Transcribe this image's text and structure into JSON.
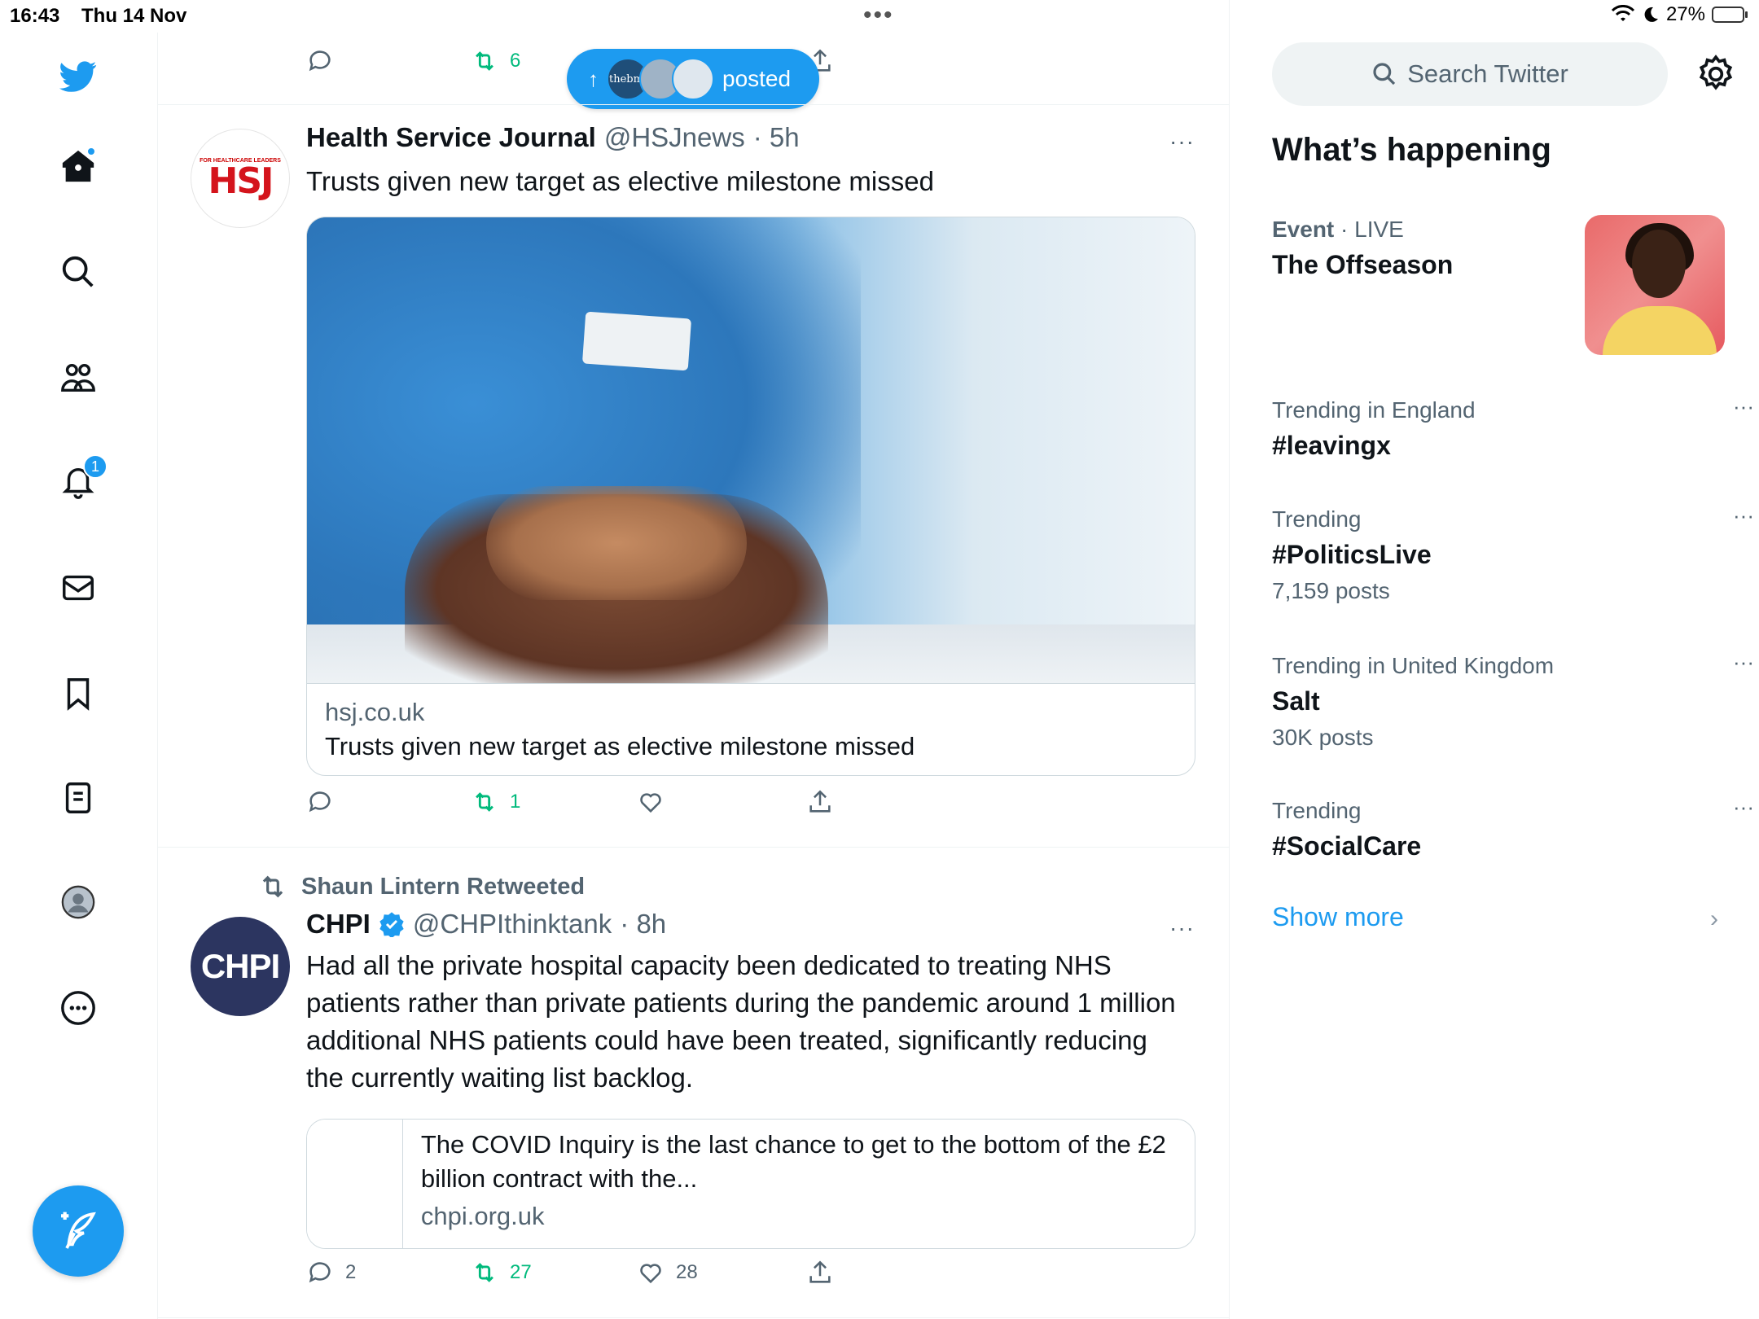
{
  "status_bar": {
    "time": "16:43",
    "date": "Thu 14 Nov",
    "battery": "27%",
    "battery_level": 0.27
  },
  "nav": {
    "notifications_count": "1"
  },
  "top_tweet_actions": {
    "retweets": "6"
  },
  "posted_pill": {
    "label": "posted",
    "avatar_text": "thebmj"
  },
  "tweets": [
    {
      "name": "Health Service Journal",
      "handle": "@HSJnews",
      "time": "· 5h",
      "avatar_small": "FOR HEALTHCARE LEADERS",
      "avatar_logo": "HSJ",
      "text": "Trusts given new target as elective milestone missed",
      "card": {
        "domain": "hsj.co.uk",
        "title": "Trusts given new target as elective milestone missed"
      },
      "replies": "",
      "retweets": "1",
      "likes": "",
      "more": "···"
    },
    {
      "retweeted_by": "Shaun Lintern Retweeted",
      "name": "CHPI",
      "handle": "@CHPIthinktank",
      "time": "· 8h",
      "avatar_text": "CHPI",
      "text": "Had all the private hospital capacity been dedicated to treating NHS patients rather than private patients during the pandemic around 1 million additional NHS patients could have been treated, significantly reducing the currently waiting list backlog.",
      "card": {
        "title": "The COVID Inquiry is the last chance to get to the bottom of the £2 billion contract with the...",
        "domain": "chpi.org.uk"
      },
      "replies": "2",
      "retweets": "27",
      "likes": "28",
      "more": "···"
    }
  ],
  "sidebar": {
    "search_placeholder": "Search Twitter",
    "section_title": "What’s happening",
    "event": {
      "category": "Event",
      "status": "· LIVE",
      "topic": "The Offseason"
    },
    "trends": [
      {
        "category": "Trending in England",
        "topic": "#leavingx",
        "count": ""
      },
      {
        "category": "Trending",
        "topic": "#PoliticsLive",
        "count": "7,159 posts"
      },
      {
        "category": "Trending in United Kingdom",
        "topic": "Salt",
        "count": "30K posts"
      },
      {
        "category": "Trending",
        "topic": "#SocialCare",
        "count": ""
      }
    ],
    "show_more": "Show more",
    "more_glyph": "···"
  },
  "colors": {
    "accent": "#1d9bf0",
    "retweet": "#00ba7c",
    "secondary_text": "#536471",
    "hsj_red": "#d4141c",
    "chpi_navy": "#2c3560"
  }
}
